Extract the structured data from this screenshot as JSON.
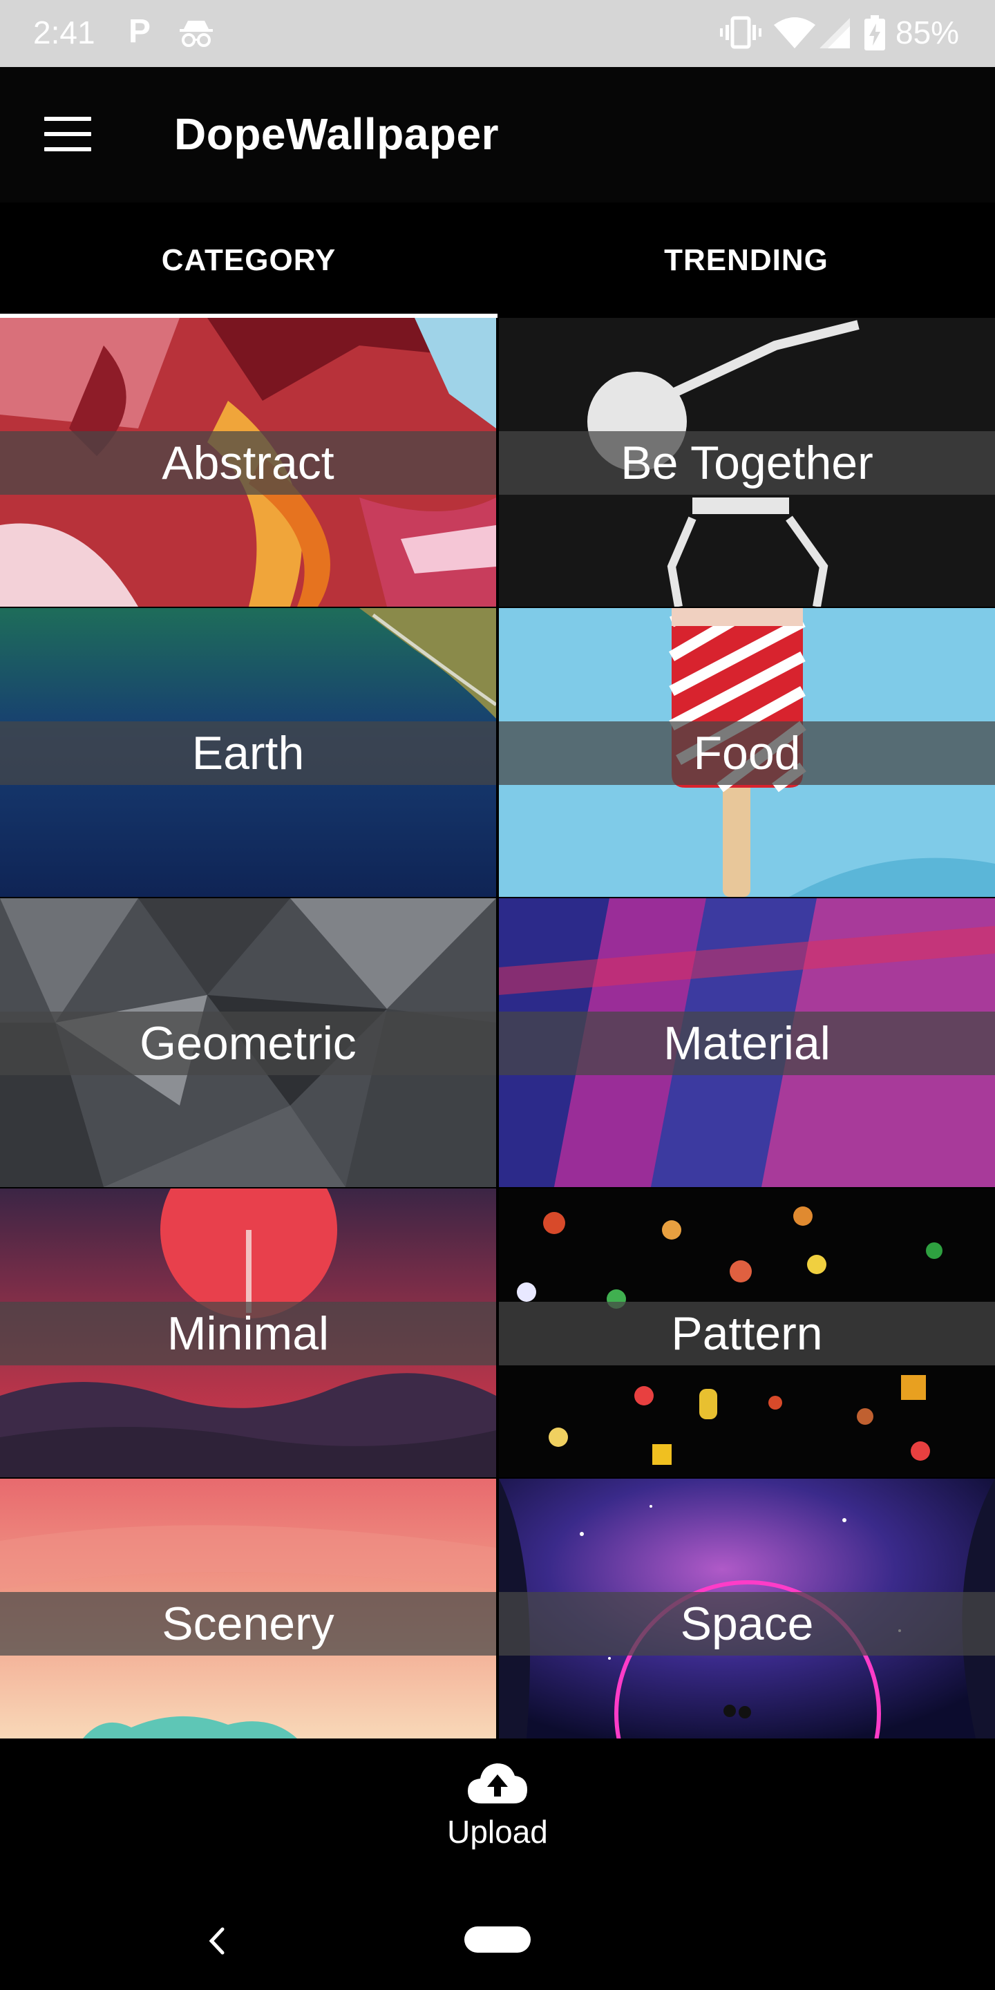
{
  "status_bar": {
    "time": "2:41",
    "p_icon": "P",
    "battery_pct": "85%",
    "icons": [
      "parking-icon",
      "incognito-icon",
      "vibrate-icon",
      "wifi-icon",
      "cell-signal-icon",
      "battery-charging-icon"
    ]
  },
  "app_bar": {
    "title": "DopeWallpaper",
    "menu_icon": "menu-icon"
  },
  "tabs": [
    {
      "label": "CATEGORY",
      "active": true
    },
    {
      "label": "TRENDING",
      "active": false
    }
  ],
  "categories": [
    {
      "label": "Abstract"
    },
    {
      "label": "Be Together"
    },
    {
      "label": "Earth"
    },
    {
      "label": "Food"
    },
    {
      "label": "Geometric"
    },
    {
      "label": "Material"
    },
    {
      "label": "Minimal"
    },
    {
      "label": "Pattern"
    },
    {
      "label": "Scenery"
    },
    {
      "label": "Space"
    }
  ],
  "bottom": {
    "upload_label": "Upload",
    "upload_icon": "cloud-upload-icon"
  },
  "nav": {
    "back_icon": "back-icon",
    "home_icon": "home-pill-icon"
  }
}
